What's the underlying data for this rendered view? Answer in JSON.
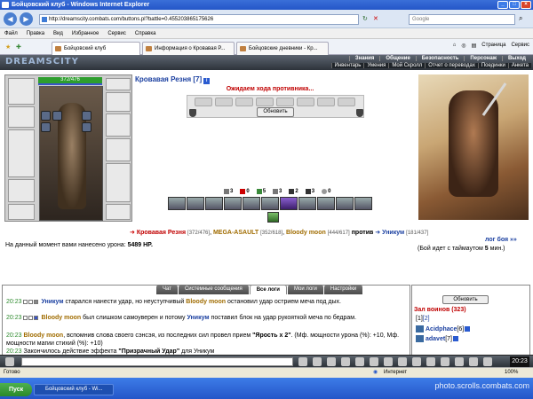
{
  "window": {
    "title": "Бойцовский клуб - Windows Internet Explorer"
  },
  "browser": {
    "url": "http://dreamscity.combats.com/buttons.pl?battle=0.455203865175626",
    "search_placeholder": "Google",
    "menu": [
      "Файл",
      "Правка",
      "Вид",
      "Избранное",
      "Сервис",
      "Справка"
    ],
    "tabs": [
      {
        "label": "Бойцовский клуб",
        "active": true
      },
      {
        "label": "Информация о Кровавая Р...",
        "active": false
      },
      {
        "label": "Бойцовские дневники - Кр...",
        "active": false
      }
    ],
    "tools": {
      "page": "Страница",
      "service": "Сервис"
    }
  },
  "game": {
    "logo": "DREAMSCITY",
    "menu_top": [
      "Знания",
      "Общение",
      "Безопасность",
      "Персонаж",
      "Выход"
    ],
    "menu_bottom": [
      "Инвентарь",
      "Умения",
      "Мой Скролл",
      "Отчет о переводах",
      "Поединки",
      "Анкета"
    ],
    "hp": "372/476",
    "player_name": "Кровавая Резня",
    "player_level": "[7]",
    "status": "Ожидаем хода противника...",
    "refresh_label": "Обновить",
    "stats": [
      {
        "icon": "knife-icon",
        "value": "3"
      },
      {
        "icon": "drop-icon",
        "value": "0"
      },
      {
        "icon": "star-icon",
        "value": "5"
      },
      {
        "icon": "shield-icon",
        "value": "3"
      },
      {
        "icon": "cross-icon",
        "value": "2"
      },
      {
        "icon": "heart-icon",
        "value": "3"
      },
      {
        "icon": "circle-icon",
        "value": "0"
      }
    ],
    "battle": {
      "team1": [
        {
          "name": "Кровавая Резня",
          "hp": "[372/476]"
        },
        {
          "name": "MEGA-ASAULT",
          "hp": "[352/618]"
        },
        {
          "name": "Bloody moon",
          "hp": "[444/617]"
        }
      ],
      "versus": "против",
      "team2": [
        {
          "name": "Уникум",
          "hp": "[181/437]"
        }
      ]
    },
    "damage_text": "На данный момент вами нанесено урона:",
    "damage_value": "5489 HP.",
    "battle_log_link": "лог боя »»",
    "timeout_text_a": "(Бой идет с таймаутом",
    "timeout_value": "5",
    "timeout_text_b": "мин.)"
  },
  "chat": {
    "tabs": [
      {
        "label": "Чат",
        "active": false
      },
      {
        "label": "Системные сообщения",
        "active": false
      },
      {
        "label": "Все логи",
        "active": true
      },
      {
        "label": "Мои логи",
        "active": false
      },
      {
        "label": "Настройки",
        "active": false
      }
    ],
    "messages": [
      {
        "time": "20:23",
        "actor": "Уникум",
        "a": " старался нанести удар, но неуступчивый ",
        "target": "Bloody moon",
        "b": " остановил удар острием меча под дых."
      },
      {
        "time": "20:23",
        "actor": "Bloody moon",
        "a": " был слишком самоуверен и потому ",
        "target": "Уникум",
        "b": " поставил блок на удар рукояткой меча по бедрам."
      },
      {
        "time": "20:23",
        "actor": "Bloody moon",
        "a": ", вспомнив слова своего сэнсэя, из последних сил провел прием ",
        "target": "\"Ярость х 2\"",
        "b": ". (Мф. мощности урона (%): +10, Мф. мощности магии стихий (%): +10)"
      },
      {
        "time": "20:23",
        "actor": "",
        "a": "Закончилось действие эффекта ",
        "target": "\"Призрачный Удар\"",
        "b": " для Уникум"
      }
    ]
  },
  "room": {
    "refresh_label": "Обновить",
    "title": "Зал воинов (323)",
    "pages": [
      "[1]",
      "[2]"
    ],
    "players": [
      {
        "name": "Acidphace",
        "level": "[6]"
      },
      {
        "name": "adavet",
        "level": "[7]"
      }
    ]
  },
  "bottombar": {
    "clock": "20:23"
  },
  "statusbar": {
    "status": "Готово",
    "zone": "Интернет",
    "zoom": "100%"
  },
  "taskbar": {
    "start": "Пуск",
    "task": "Бойцовский клуб - Wi...",
    "watermark": "photo.scrolls.combats.com"
  }
}
